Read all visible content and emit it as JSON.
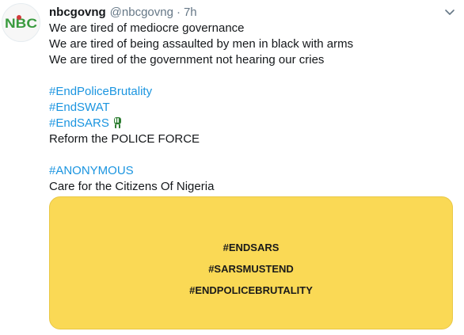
{
  "tweet": {
    "display_name": "nbcgovng",
    "handle": "@nbcgovng",
    "separator": "·",
    "time": "7h",
    "avatar_text": "NBC",
    "more_icon": "chevron-down-icon",
    "lines": [
      "We are tired of mediocre governance",
      "We are tired of being assaulted by men in black with arms",
      "We are tired of the government not hearing our cries"
    ],
    "hashtags": [
      "#EndPoliceBrutality",
      "#EndSWAT",
      "#EndSARS"
    ],
    "emoji_icon": "raised-fist-icon",
    "reform_line": "Reform the POLICE FORCE",
    "anon_hashtag": "#ANONYMOUS",
    "care_line": "Care for the Citizens Of Nigeria",
    "card_lines": [
      "#ENDSARS",
      "#SARSMUSTEND",
      "#ENDPOLICEBRUTALITY"
    ],
    "colors": {
      "hashtag": "#1b95e0",
      "card_bg": "#fad955",
      "text": "#14171a",
      "muted": "#657786",
      "logo_green": "#3a9b3f"
    }
  }
}
